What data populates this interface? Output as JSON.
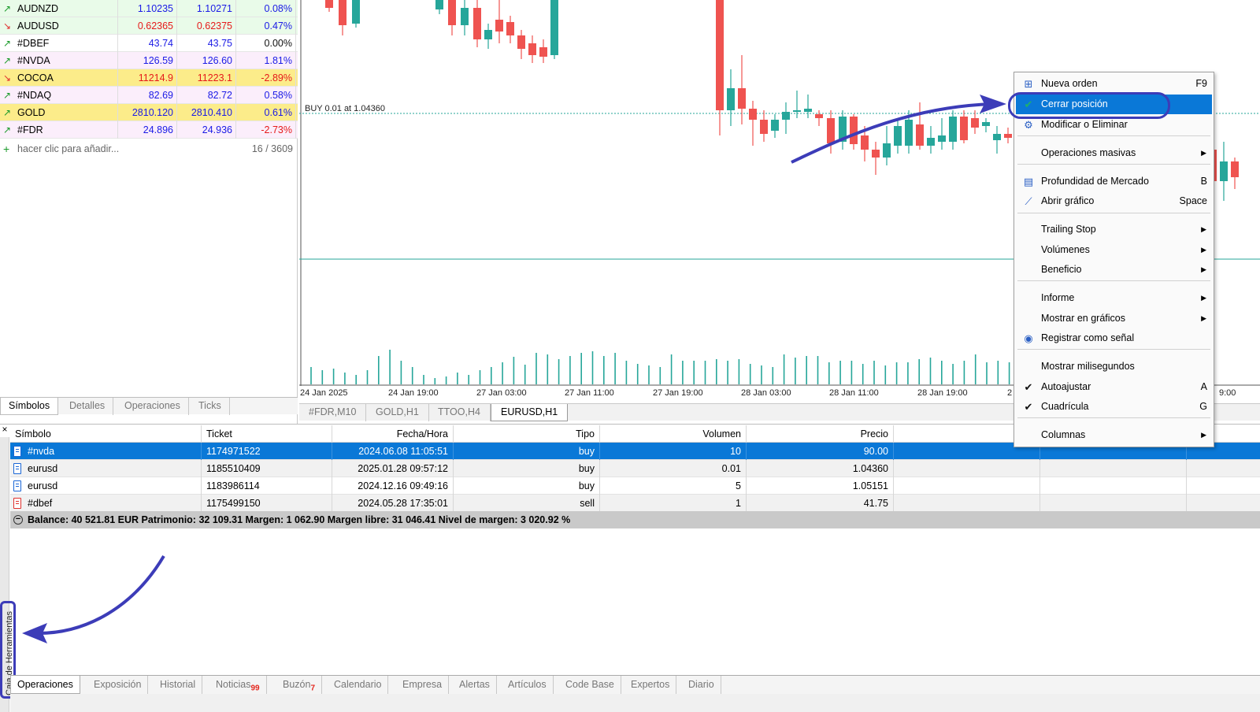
{
  "market_watch": {
    "rows": [
      {
        "dir": "up",
        "symbol": "AUDNZD",
        "bid": "1.10235",
        "ask": "1.10271",
        "change": "0.08%",
        "bg": "green",
        "color": "blue"
      },
      {
        "dir": "down",
        "symbol": "AUDUSD",
        "bid": "0.62365",
        "ask": "0.62375",
        "change": "0.47%",
        "bg": "green",
        "color": "red"
      },
      {
        "dir": "up",
        "symbol": "#DBEF",
        "bid": "43.74",
        "ask": "43.75",
        "change": "0.00%",
        "bg": "white",
        "color": "blue"
      },
      {
        "dir": "up",
        "symbol": "#NVDA",
        "bid": "126.59",
        "ask": "126.60",
        "change": "1.81%",
        "bg": "pink",
        "color": "blue"
      },
      {
        "dir": "down",
        "symbol": "COCOA",
        "bid": "11214.9",
        "ask": "11223.1",
        "change": "-2.89%",
        "bg": "yellow",
        "color": "red"
      },
      {
        "dir": "up",
        "symbol": "#NDAQ",
        "bid": "82.69",
        "ask": "82.72",
        "change": "0.58%",
        "bg": "pink",
        "color": "blue"
      },
      {
        "dir": "up",
        "symbol": "GOLD",
        "bid": "2810.120",
        "ask": "2810.410",
        "change": "0.61%",
        "bg": "yellow",
        "color": "blue"
      },
      {
        "dir": "up",
        "symbol": "#FDR",
        "bid": "24.896",
        "ask": "24.936",
        "change": "-2.73%",
        "bg": "pink",
        "color": "blue"
      }
    ],
    "add_label": "hacer clic para añadir...",
    "count": "16 / 3609",
    "tabs": [
      "Símbolos",
      "Detalles",
      "Operaciones",
      "Ticks"
    ]
  },
  "chart": {
    "position_label": "BUY 0.01 at 1.04360",
    "time_labels": [
      "24 Jan 2025",
      "24 Jan 19:00",
      "27 Jan 03:00",
      "27 Jan 11:00",
      "27 Jan 19:00",
      "28 Jan 03:00",
      "28 Jan 11:00",
      "28 Jan 19:00",
      "2",
      "9:00"
    ],
    "tabs": [
      "#FDR,M10",
      "GOLD,H1",
      "TTOO,H4",
      "EURUSD,H1"
    ],
    "bull_color": "#26a69a",
    "bear_color": "#ef5350"
  },
  "context_menu": {
    "items": [
      {
        "icon": "plus-doc-icon",
        "label": "Nueva orden",
        "shortcut": "F9"
      },
      {
        "icon": "check-icon",
        "label": "Cerrar posición",
        "shortcut": "",
        "highlighted": true
      },
      {
        "icon": "gear-icon",
        "label": "Modificar o Eliminar",
        "shortcut": ""
      },
      {
        "label": "Operaciones masivas",
        "submenu": true
      },
      {
        "icon": "depth-icon",
        "label": "Profundidad de Mercado",
        "shortcut": "B"
      },
      {
        "icon": "chart-icon",
        "label": "Abrir gráfico",
        "shortcut": "Space"
      },
      {
        "label": "Trailing Stop",
        "submenu": true
      },
      {
        "label": "Volúmenes",
        "submenu": true
      },
      {
        "label": "Beneficio",
        "submenu": true
      },
      {
        "label": "Informe",
        "submenu": true
      },
      {
        "label": "Mostrar en gráficos",
        "submenu": true
      },
      {
        "icon": "signal-icon",
        "label": "Registrar como señal",
        "shortcut": ""
      },
      {
        "label": "Mostrar milisegundos",
        "shortcut": ""
      },
      {
        "icon": "checkmark-icon",
        "label": "Autoajustar",
        "shortcut": "A"
      },
      {
        "icon": "checkmark-icon",
        "label": "Cuadrícula",
        "shortcut": "G"
      },
      {
        "label": "Columnas",
        "submenu": true
      }
    ]
  },
  "toolbox": {
    "close_glyph": "×",
    "vertical_label": "Caja de Herramientas",
    "columns": [
      "Símbolo",
      "Ticket",
      "Fecha/Hora",
      "Tipo",
      "Volumen",
      "Precio"
    ],
    "rows": [
      {
        "symbol": "#nvda",
        "ticket": "1174971522",
        "datetime": "2024.06.08 11:05:51",
        "type": "buy",
        "volume": "10",
        "price": "90.00"
      },
      {
        "symbol": "eurusd",
        "ticket": "1185510409",
        "datetime": "2025.01.28 09:57:12",
        "type": "buy",
        "volume": "0.01",
        "price": "1.04360"
      },
      {
        "symbol": "eurusd",
        "ticket": "1183986114",
        "datetime": "2024.12.16 09:49:16",
        "type": "buy",
        "volume": "5",
        "price": "1.05151"
      },
      {
        "symbol": "#dbef",
        "ticket": "1175499150",
        "datetime": "2024.05.28 17:35:01",
        "type": "sell",
        "volume": "1",
        "price": "41.75"
      }
    ],
    "balance": "Balance: 40 521.81 EUR  Patrimonio: 32 109.31  Margen: 1 062.90  Margen libre: 31 046.41  Nivel de margen: 3 020.92 %",
    "tabs": [
      {
        "label": "Operaciones"
      },
      {
        "label": "Exposición"
      },
      {
        "label": "Historial"
      },
      {
        "label": "Noticias",
        "badge": "99"
      },
      {
        "label": "Buzón",
        "badge": "7"
      },
      {
        "label": "Calendario"
      },
      {
        "label": "Empresa"
      },
      {
        "label": "Alertas"
      },
      {
        "label": "Artículos"
      },
      {
        "label": "Code Base"
      },
      {
        "label": "Expertos"
      },
      {
        "label": "Diario"
      }
    ]
  },
  "annotation_color": "#3c3cb8"
}
